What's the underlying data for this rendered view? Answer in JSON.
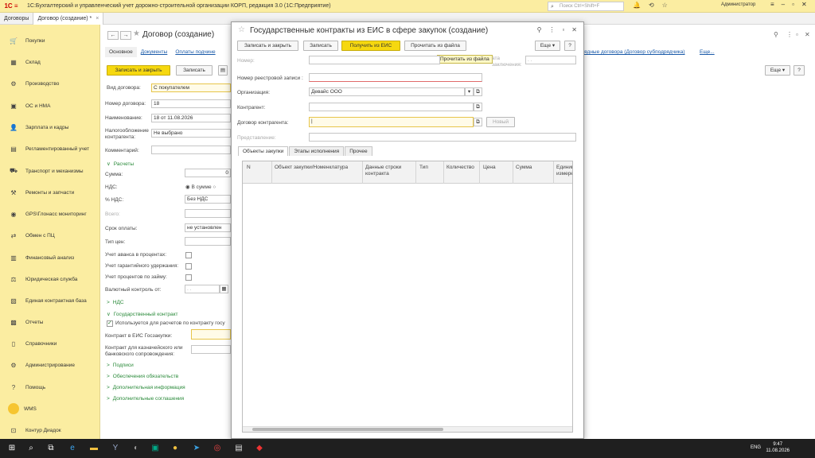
{
  "app": {
    "title": "1С:Бухгалтерский и управленческий учет дорожно-строительной организации КОРП, редакция 3.0  (1С:Предприятие)",
    "search_placeholder": "Поиск Ctrl+Shift+F",
    "user": "Администратор"
  },
  "tabs": [
    {
      "label": "Договоры"
    },
    {
      "label": "Договор (создание) *"
    }
  ],
  "sidebar": {
    "items": [
      {
        "label": "Покупки",
        "icon": "cart-icon"
      },
      {
        "label": "Склад",
        "icon": "warehouse-icon"
      },
      {
        "label": "Производство",
        "icon": "factory-icon"
      },
      {
        "label": "ОС и НМА",
        "icon": "assets-icon"
      },
      {
        "label": "Зарплата и кадры",
        "icon": "people-icon"
      },
      {
        "label": "Регламентированный учет",
        "icon": "ledger-icon"
      },
      {
        "label": "Транспорт и механизмы",
        "icon": "truck-icon"
      },
      {
        "label": "Ремонты и запчасти",
        "icon": "wrench-icon"
      },
      {
        "label": "GPS\\Глонасс мониторинг",
        "icon": "gps-icon"
      },
      {
        "label": "Обмен с ПЦ",
        "icon": "exchange-icon"
      },
      {
        "label": "Финансовый анализ",
        "icon": "chart-icon"
      },
      {
        "label": "Юридическая служба",
        "icon": "law-icon"
      },
      {
        "label": "Единая контрактная база",
        "icon": "database-icon"
      },
      {
        "label": "Отчеты",
        "icon": "report-icon"
      },
      {
        "label": "Справочники",
        "icon": "book-icon"
      },
      {
        "label": "Администрирование",
        "icon": "gear-icon"
      },
      {
        "label": "Помощь",
        "icon": "help-icon"
      },
      {
        "label": "WMS",
        "icon": "wms-icon"
      },
      {
        "label": "Контур Диадок",
        "icon": "diadoc-icon"
      }
    ]
  },
  "doc": {
    "title": "Договор (создание)",
    "subtabs": [
      "Основное",
      "Документы",
      "Оплаты подчине"
    ],
    "right_link": "ядные договора (Договор субподрядчика)",
    "right_link2": "Еще...",
    "btn_save_close": "Записать и закрыть",
    "btn_save": "Записать",
    "btn_more": "Еще",
    "fields": {
      "vid_label": "Вид договора:",
      "vid_value": "С покупателем",
      "number_label": "Номер договора:",
      "number_value": "18",
      "name_label": "Наименование:",
      "name_value": "18 от 11.08.2026",
      "tax_label": "Налогообложение контрагента:",
      "tax_value": "Не выбрано",
      "comment_label": "Комментарий:",
      "payments_section": "Расчеты",
      "sum_label": "Сумма:",
      "sum_value": "0",
      "nds_label": "НДС:",
      "nds_option": "В сумме",
      "nds_pct_label": "% НДС:",
      "nds_pct_value": "Без НДС",
      "total_label": "Всего:",
      "term_label": "Срок оплаты:",
      "term_value": "не установлен",
      "price_type_label": "Тип цен:",
      "advance_label": "Учет аванса в процентах:",
      "guarantee_label": "Учет гарантийного удержания:",
      "loan_label": "Учет процентов по займу:",
      "currency_label": "Валютный контроль от:",
      "currency_value": ". .",
      "nds_section": "НДС",
      "gov_section": "Государственный контракт",
      "gov_check": "Используется для расчетов по контракту госу",
      "eis_label": "Контракт в ЕИС Госзакупки:",
      "treasury_label": "Контракт для казначейского или банковского сопровождения:",
      "signatures_section": "Подписи",
      "guarantees_section": "Обеспечения обязательств",
      "extra_info_section": "Дополнительная информация",
      "extra_agreements_section": "Дополнительные соглашения"
    }
  },
  "modal": {
    "title": "Государственные контракты из ЕИС в сфере закупок (создание)",
    "btn_save_close": "Записать и закрыть",
    "btn_save": "Записать",
    "btn_get": "Получить из ЕИС",
    "btn_read_file": "Прочитать из файла",
    "btn_more": "Еще",
    "btn_help": "?",
    "tooltip": "Прочитать из файла",
    "number_label": "Номер:",
    "date_label": "Дата заключения:",
    "date_label_a": "ата",
    "date_label_b": "заключения:",
    "date_value": ". .",
    "reg_label": "Номер реестровой записи :",
    "org_label": "Организация:",
    "org_value": "Девайс ООО",
    "contractor_label": "Контрагент:",
    "contract_label": "Договор контрагента:",
    "new_btn": "Новый",
    "repr_label": "Представление:",
    "tabs": [
      "Объекты закупки",
      "Этапы исполнения",
      "Прочее"
    ],
    "columns": [
      "N",
      "Объект закупки/Номенклатура",
      "Данные строки контракта",
      "Тип",
      "Количество",
      "Цена",
      "Сумма",
      "Единица измерения"
    ]
  },
  "taskbar": {
    "lang": "ENG",
    "time": "9:47",
    "date": "11.08.2026"
  }
}
